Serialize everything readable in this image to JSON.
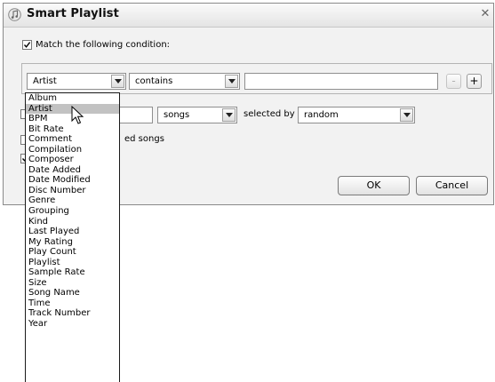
{
  "window": {
    "title": "Smart Playlist",
    "icon": "music-note-icon",
    "close_icon": "close-icon"
  },
  "match": {
    "checked": true,
    "label": "Match the following condition:"
  },
  "rule": {
    "field_value": "Artist",
    "operator_value": "contains",
    "text_value": "",
    "remove_label": "-",
    "add_label": "+"
  },
  "limit": {
    "checked": false,
    "count_value": "",
    "unit_value": "songs",
    "selected_by_label": "selected by",
    "selected_by_value": "random"
  },
  "checked_songs": {
    "checked": false,
    "label_visible": "ed songs"
  },
  "live_update": {
    "checked": true
  },
  "buttons": {
    "ok": "OK",
    "cancel": "Cancel"
  },
  "field_options": [
    "Album",
    "Artist",
    "BPM",
    "Bit Rate",
    "Comment",
    "Compilation",
    "Composer",
    "Date Added",
    "Date Modified",
    "Disc Number",
    "Genre",
    "Grouping",
    "Kind",
    "Last Played",
    "My Rating",
    "Play Count",
    "Playlist",
    "Sample Rate",
    "Size",
    "Song Name",
    "Time",
    "Track Number",
    "Year"
  ],
  "highlighted_option": "Artist",
  "colors": {
    "highlight": "#c2c2c2",
    "dialog_bg": "#f2f2f2"
  }
}
